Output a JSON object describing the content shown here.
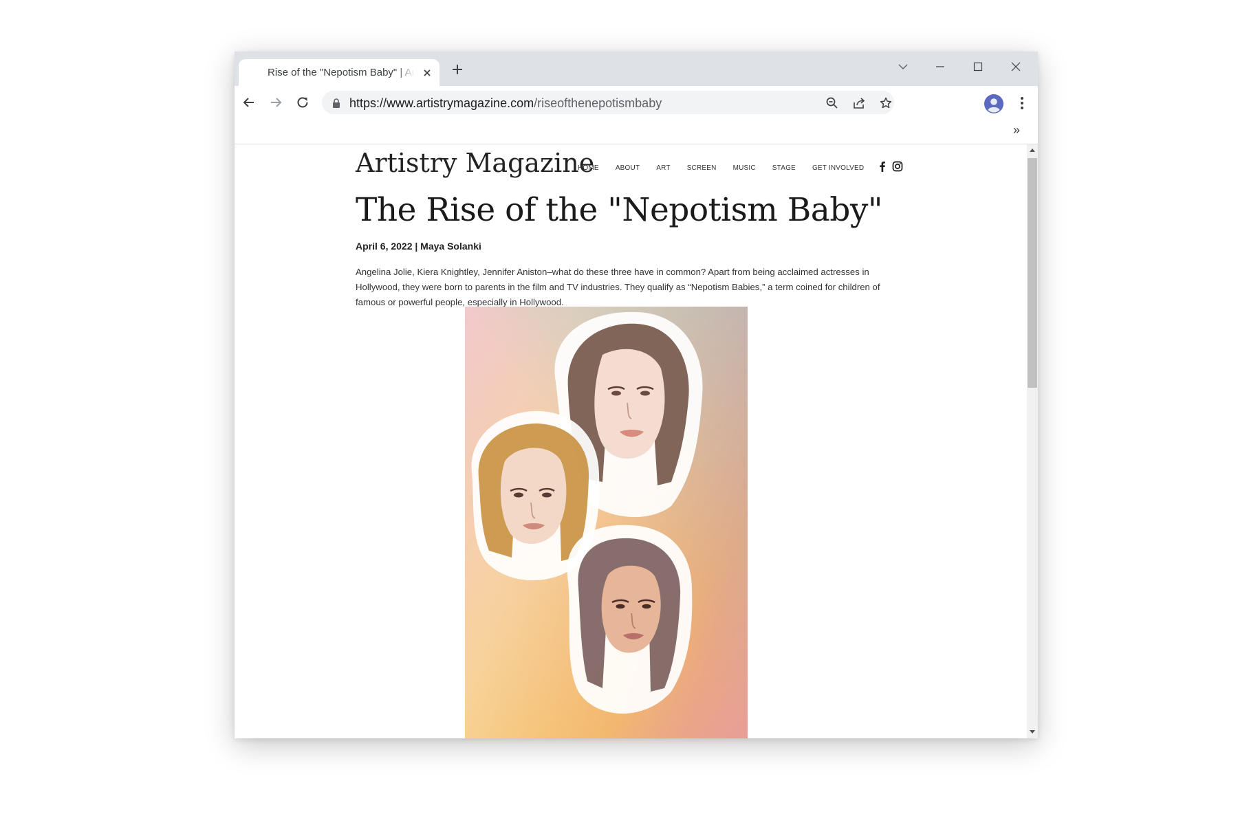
{
  "browser": {
    "tab_title": "Rise of the \"Nepotism Baby\" | Artistry Magazine",
    "url_domain": "https://www.artistrymagazine.com",
    "url_path": "/riseofthenepotismbaby",
    "bookmarks_overflow": "»"
  },
  "site": {
    "logo": "Artistry Magazine",
    "nav": [
      "HOME",
      "ABOUT",
      "ART",
      "SCREEN",
      "MUSIC",
      "STAGE",
      "GET INVOLVED"
    ]
  },
  "article": {
    "title": "The Rise of the \"Nepotism Baby\"",
    "byline": "April 6, 2022 | Maya Solanki",
    "intro": "Angelina Jolie, Kiera Knightley, Jennifer Aniston–what do these three have in common? Apart from being acclaimed actresses in Hollywood, they were born to parents in the film and TV industries. They qualify as “Nepotism Babies,” a term coined for children of famous or powerful people, especially in Hollywood."
  },
  "colors": {
    "tabstrip": "#dee1e6",
    "omnibox": "#f1f3f4",
    "profile": "#5b6abf"
  }
}
